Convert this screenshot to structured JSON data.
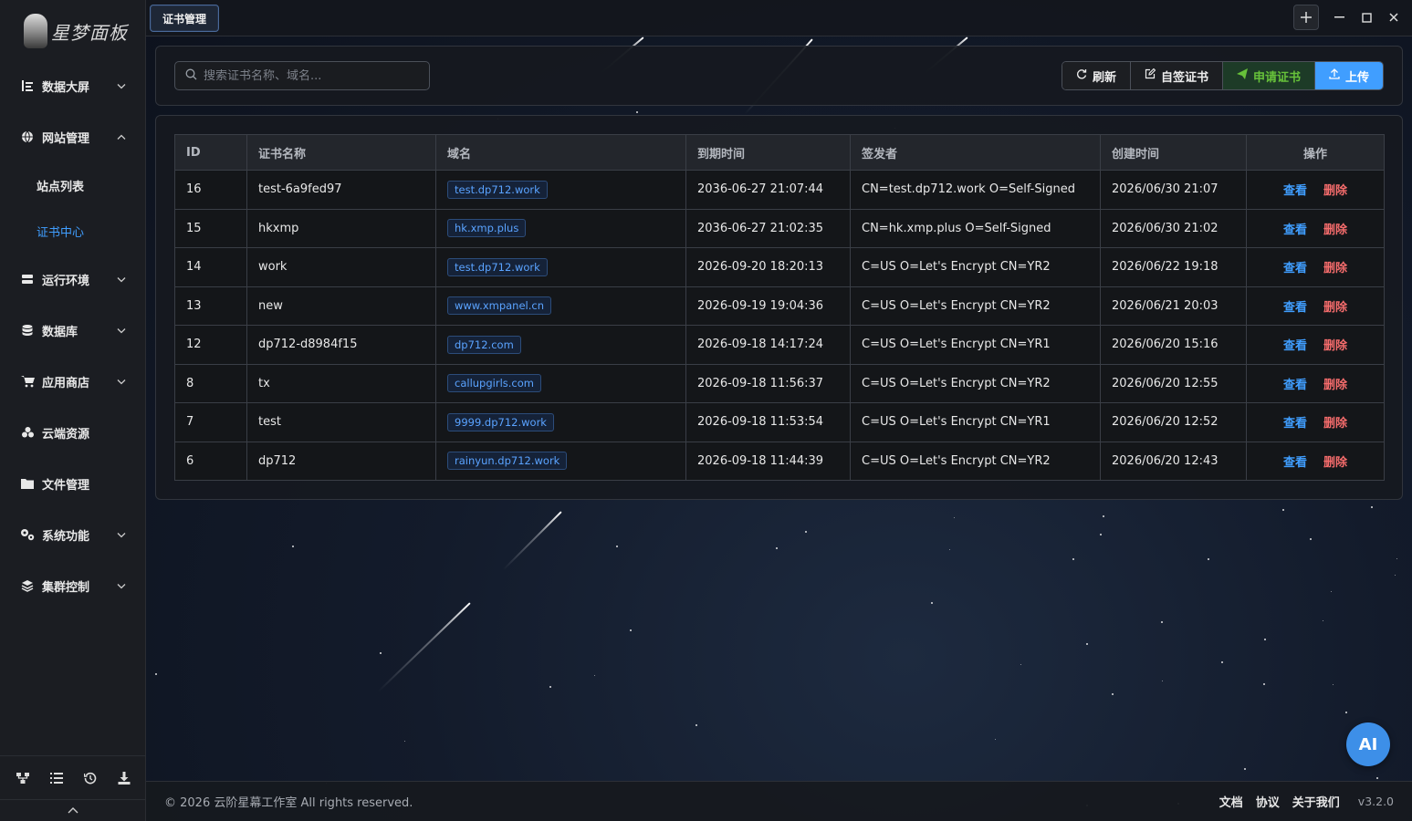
{
  "app": {
    "brand": "星梦面板"
  },
  "sidebar": {
    "items": [
      {
        "label": "数据大屏",
        "icon": "dashboard-icon",
        "expandable": true
      },
      {
        "label": "网站管理",
        "icon": "globe-icon",
        "expandable": true,
        "expanded": true,
        "children": [
          {
            "label": "站点列表"
          },
          {
            "label": "证书中心",
            "active": true
          }
        ]
      },
      {
        "label": "运行环境",
        "icon": "server-icon",
        "expandable": true
      },
      {
        "label": "数据库",
        "icon": "database-icon",
        "expandable": true
      },
      {
        "label": "应用商店",
        "icon": "cart-icon",
        "expandable": true
      },
      {
        "label": "云端资源",
        "icon": "cloud-icon",
        "expandable": false
      },
      {
        "label": "文件管理",
        "icon": "folder-icon",
        "expandable": false
      },
      {
        "label": "系统功能",
        "icon": "gears-icon",
        "expandable": true
      },
      {
        "label": "集群控制",
        "icon": "layers-icon",
        "expandable": true
      }
    ],
    "bottom_icons": [
      "network-icon",
      "list-icon",
      "history-icon",
      "download-icon"
    ]
  },
  "topbar": {
    "active_tab": "证书管理"
  },
  "toolbar": {
    "search_placeholder": "搜索证书名称、域名...",
    "refresh_label": "刷新",
    "self_sign_label": "自签证书",
    "apply_label": "申请证书",
    "upload_label": "上传"
  },
  "table": {
    "columns": [
      "ID",
      "证书名称",
      "域名",
      "到期时间",
      "签发者",
      "创建时间",
      "操作"
    ],
    "view_label": "查看",
    "delete_label": "删除",
    "rows": [
      {
        "id": "16",
        "name": "test-6a9fed97",
        "domain": "test.dp712.work",
        "expires": "2036-06-27 21:07:44",
        "issuer": "CN=test.dp712.work O=Self-Signed",
        "created": "2026/06/30 21:07"
      },
      {
        "id": "15",
        "name": "hkxmp",
        "domain": "hk.xmp.plus",
        "expires": "2036-06-27 21:02:35",
        "issuer": "CN=hk.xmp.plus O=Self-Signed",
        "created": "2026/06/30 21:02"
      },
      {
        "id": "14",
        "name": "work",
        "domain": "test.dp712.work",
        "expires": "2026-09-20 18:20:13",
        "issuer": "C=US O=Let's Encrypt CN=YR2",
        "created": "2026/06/22 19:18"
      },
      {
        "id": "13",
        "name": "new",
        "domain": "www.xmpanel.cn",
        "expires": "2026-09-19 19:04:36",
        "issuer": "C=US O=Let's Encrypt CN=YR2",
        "created": "2026/06/21 20:03"
      },
      {
        "id": "12",
        "name": "dp712-d8984f15",
        "domain": "dp712.com",
        "expires": "2026-09-18 14:17:24",
        "issuer": "C=US O=Let's Encrypt CN=YR1",
        "created": "2026/06/20 15:16"
      },
      {
        "id": "8",
        "name": "tx",
        "domain": "callupgirls.com",
        "expires": "2026-09-18 11:56:37",
        "issuer": "C=US O=Let's Encrypt CN=YR2",
        "created": "2026/06/20 12:55"
      },
      {
        "id": "7",
        "name": "test",
        "domain": "9999.dp712.work",
        "expires": "2026-09-18 11:53:54",
        "issuer": "C=US O=Let's Encrypt CN=YR1",
        "created": "2026/06/20 12:52"
      },
      {
        "id": "6",
        "name": "dp712",
        "domain": "rainyun.dp712.work",
        "expires": "2026-09-18 11:44:39",
        "issuer": "C=US O=Let's Encrypt CN=YR2",
        "created": "2026/06/20 12:43"
      }
    ]
  },
  "footer": {
    "copyright": "© 2026 云阶星幕工作室 All rights reserved.",
    "links": [
      "文档",
      "协议",
      "关于我们"
    ],
    "version": "v3.2.0"
  },
  "ai_button": {
    "label": "AI"
  },
  "colors": {
    "accent": "#409eff",
    "danger": "#f56c6c",
    "success": "#67c23a"
  }
}
